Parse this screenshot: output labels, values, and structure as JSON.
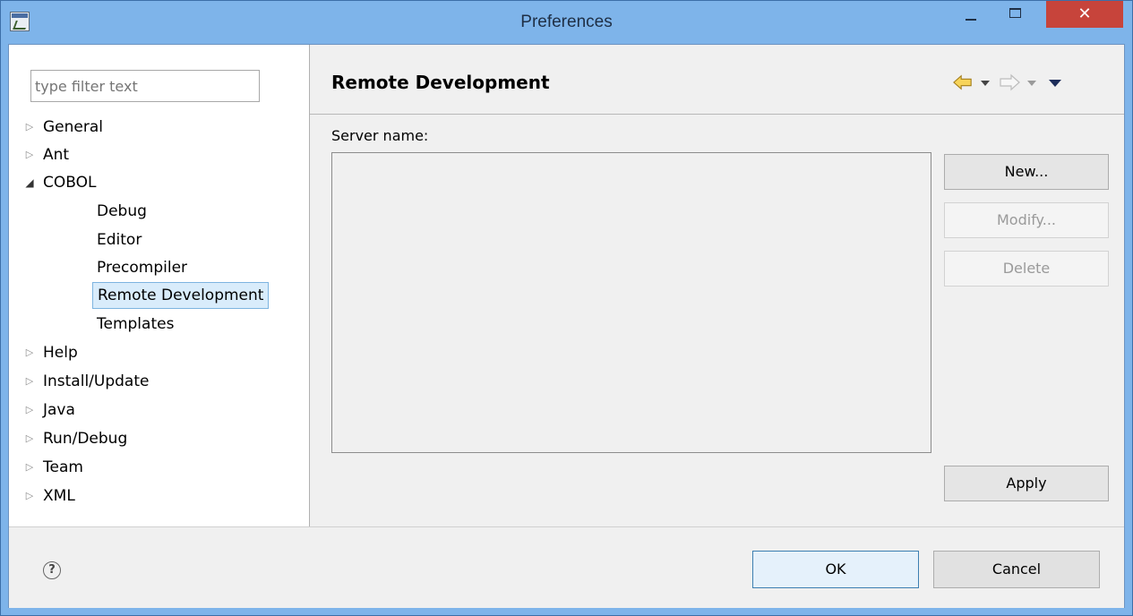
{
  "window": {
    "title": "Preferences",
    "close_glyph": "✕"
  },
  "sidebar": {
    "filter_placeholder": "type filter text",
    "items": [
      {
        "label": "General",
        "expander": "▷"
      },
      {
        "label": "Ant",
        "expander": "▷"
      },
      {
        "label": "COBOL",
        "expander": "◢"
      },
      {
        "label": "Debug"
      },
      {
        "label": "Editor"
      },
      {
        "label": "Precompiler"
      },
      {
        "label": "Remote Development",
        "selected": true
      },
      {
        "label": "Templates"
      },
      {
        "label": "Help",
        "expander": "▷"
      },
      {
        "label": "Install/Update",
        "expander": "▷"
      },
      {
        "label": "Java",
        "expander": "▷"
      },
      {
        "label": "Run/Debug",
        "expander": "▷"
      },
      {
        "label": "Team",
        "expander": "▷"
      },
      {
        "label": "XML",
        "expander": "▷"
      }
    ]
  },
  "page": {
    "title": "Remote Development",
    "server_label": "Server name:",
    "buttons": {
      "new": "New...",
      "modify": "Modify...",
      "delete": "Delete",
      "apply": "Apply"
    }
  },
  "footer": {
    "help_glyph": "?",
    "ok": "OK",
    "cancel": "Cancel"
  },
  "colors": {
    "titlebar": "#7eb4ea",
    "close_button": "#c7443b",
    "selection": "#d9ecfb",
    "nav_arrow": "#f2c744"
  },
  "icons": [
    "app-icon",
    "minimize-icon",
    "maximize-icon",
    "close-icon",
    "back-arrow-icon",
    "forward-arrow-icon",
    "view-menu-icon",
    "help-icon"
  ]
}
